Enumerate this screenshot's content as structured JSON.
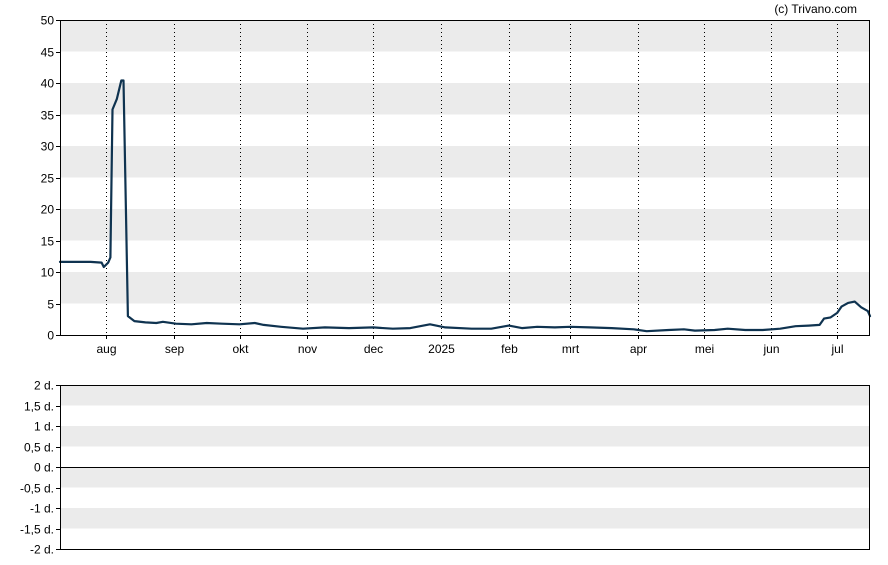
{
  "credit": "(c) Trivano.com",
  "colors": {
    "line": "#0f3350",
    "band": "#ebebeb",
    "frame": "#000000",
    "grid": "#000000"
  },
  "chart_data": [
    {
      "type": "line",
      "title": "",
      "xlabel": "",
      "ylabel": "",
      "ylim": [
        0,
        50
      ],
      "yticks": [
        "0",
        "5",
        "10",
        "15",
        "20",
        "25",
        "30",
        "35",
        "40",
        "45",
        "50"
      ],
      "xlim": [
        "2024-07-11",
        "2025-07-16"
      ],
      "xticks": [
        {
          "date": "2024-08-01",
          "label": "aug"
        },
        {
          "date": "2024-09-01",
          "label": "sep"
        },
        {
          "date": "2024-10-01",
          "label": "okt"
        },
        {
          "date": "2024-11-01",
          "label": "nov"
        },
        {
          "date": "2024-12-01",
          "label": "dec"
        },
        {
          "date": "2025-01-01",
          "label": "2025"
        },
        {
          "date": "2025-02-01",
          "label": "feb"
        },
        {
          "date": "2025-03-01",
          "label": "mrt"
        },
        {
          "date": "2025-04-01",
          "label": "apr"
        },
        {
          "date": "2025-05-01",
          "label": "mei"
        },
        {
          "date": "2025-06-01",
          "label": "jun"
        },
        {
          "date": "2025-07-01",
          "label": "jul"
        }
      ],
      "grid": "vertical-dotted",
      "series": [
        {
          "points": [
            [
              "2024-07-11",
              11.6
            ],
            [
              "2024-07-18",
              11.6
            ],
            [
              "2024-07-25",
              11.6
            ],
            [
              "2024-07-30",
              11.5
            ],
            [
              "2024-07-31",
              10.8
            ],
            [
              "2024-08-02",
              11.5
            ],
            [
              "2024-08-03",
              12.3
            ],
            [
              "2024-08-04",
              35.8
            ],
            [
              "2024-08-06",
              37.5
            ],
            [
              "2024-08-08",
              40.4
            ],
            [
              "2024-08-09",
              40.4
            ],
            [
              "2024-08-11",
              3.0
            ],
            [
              "2024-08-14",
              2.2
            ],
            [
              "2024-08-19",
              2.0
            ],
            [
              "2024-08-24",
              1.9
            ],
            [
              "2024-08-27",
              2.1
            ],
            [
              "2024-09-02",
              1.8
            ],
            [
              "2024-09-09",
              1.7
            ],
            [
              "2024-09-16",
              1.9
            ],
            [
              "2024-09-23",
              1.8
            ],
            [
              "2024-10-01",
              1.7
            ],
            [
              "2024-10-08",
              1.9
            ],
            [
              "2024-10-12",
              1.6
            ],
            [
              "2024-10-20",
              1.3
            ],
            [
              "2024-10-30",
              1.0
            ],
            [
              "2024-11-09",
              1.2
            ],
            [
              "2024-11-20",
              1.1
            ],
            [
              "2024-12-01",
              1.2
            ],
            [
              "2024-12-10",
              1.0
            ],
            [
              "2024-12-18",
              1.1
            ],
            [
              "2024-12-24",
              1.5
            ],
            [
              "2024-12-27",
              1.7
            ],
            [
              "2025-01-03",
              1.2
            ],
            [
              "2025-01-15",
              1.0
            ],
            [
              "2025-01-24",
              1.0
            ],
            [
              "2025-02-01",
              1.5
            ],
            [
              "2025-02-07",
              1.1
            ],
            [
              "2025-02-14",
              1.3
            ],
            [
              "2025-02-22",
              1.2
            ],
            [
              "2025-03-01",
              1.3
            ],
            [
              "2025-03-10",
              1.2
            ],
            [
              "2025-03-20",
              1.1
            ],
            [
              "2025-03-30",
              0.9
            ],
            [
              "2025-04-05",
              0.6
            ],
            [
              "2025-04-15",
              0.8
            ],
            [
              "2025-04-22",
              0.9
            ],
            [
              "2025-04-27",
              0.7
            ],
            [
              "2025-05-06",
              0.8
            ],
            [
              "2025-05-12",
              1.0
            ],
            [
              "2025-05-20",
              0.8
            ],
            [
              "2025-05-28",
              0.8
            ],
            [
              "2025-06-05",
              1.0
            ],
            [
              "2025-06-12",
              1.4
            ],
            [
              "2025-06-18",
              1.5
            ],
            [
              "2025-06-23",
              1.6
            ],
            [
              "2025-06-25",
              2.6
            ],
            [
              "2025-06-28",
              2.8
            ],
            [
              "2025-07-01",
              3.5
            ],
            [
              "2025-07-03",
              4.5
            ],
            [
              "2025-07-06",
              5.1
            ],
            [
              "2025-07-09",
              5.3
            ],
            [
              "2025-07-12",
              4.4
            ],
            [
              "2025-07-15",
              3.8
            ],
            [
              "2025-07-16",
              3.0
            ]
          ]
        }
      ]
    },
    {
      "type": "line",
      "title": "",
      "xlabel": "",
      "ylabel": "",
      "ylim": [
        -2,
        2
      ],
      "yticks": [
        "2 d.",
        "1,5 d.",
        "1 d.",
        "0,5 d.",
        "0 d.",
        "-0,5 d.",
        "-1 d.",
        "-1,5 d.",
        "-2 d."
      ],
      "reference_line": 0,
      "series": []
    }
  ]
}
